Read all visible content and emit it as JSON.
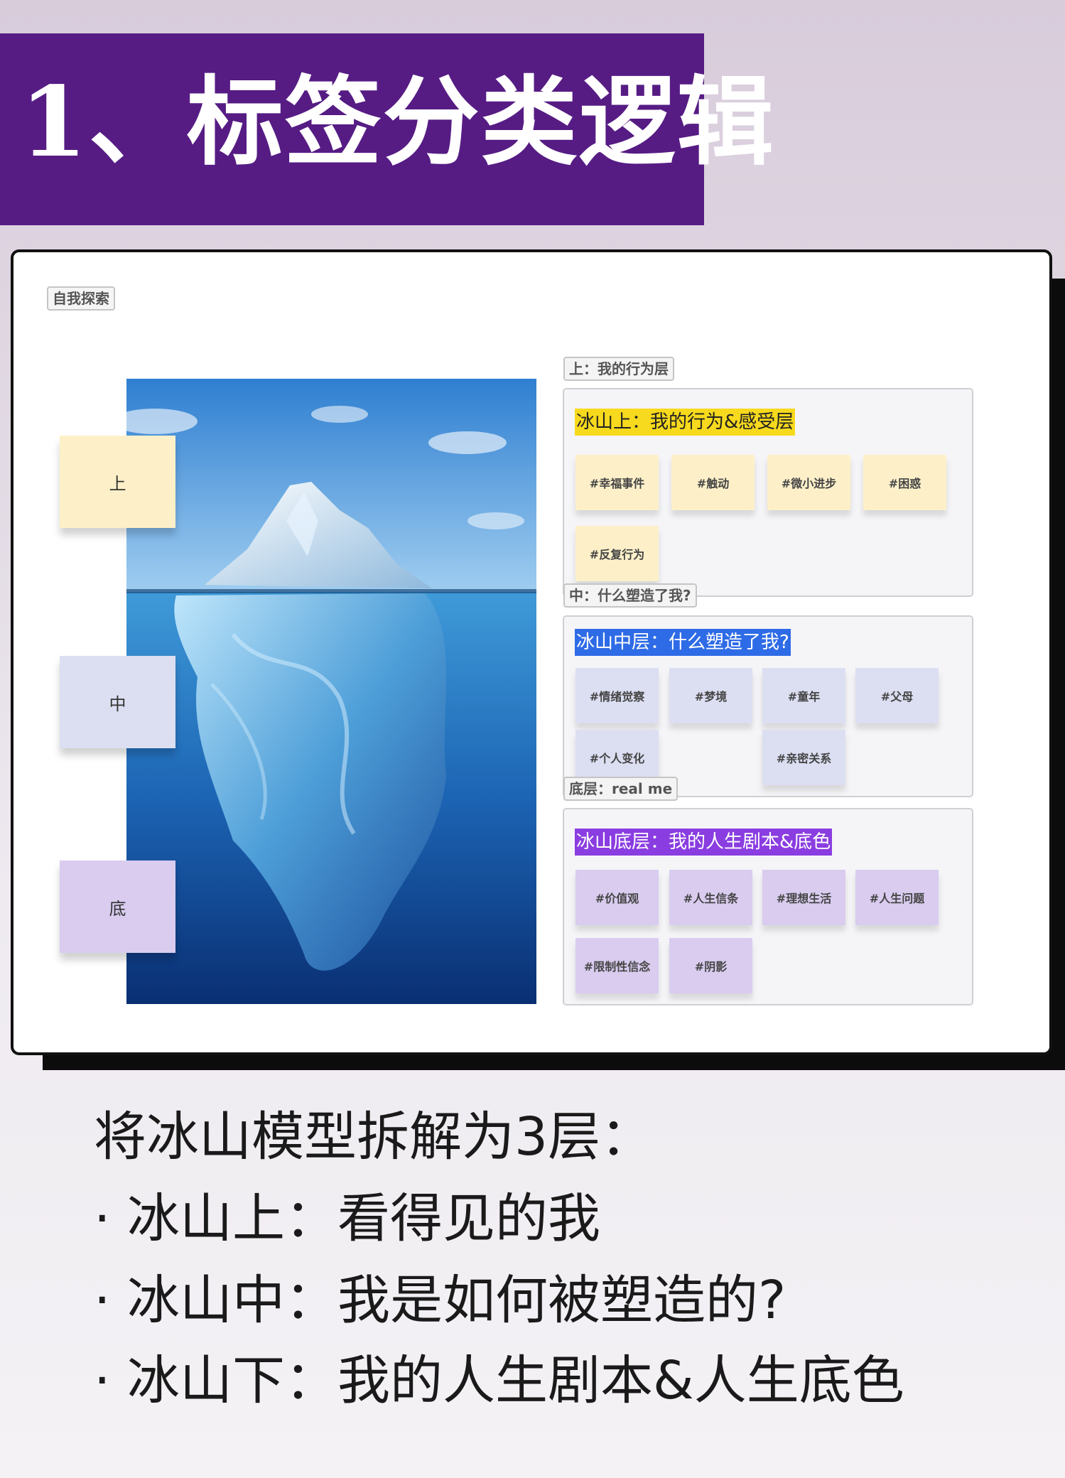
{
  "title": "1、标签分类逻辑",
  "board": {
    "tag": "自我探索",
    "levels": [
      "上",
      "中",
      "底"
    ],
    "sections": [
      {
        "tag": "上：我的行为层",
        "heading": "冰山上：我的行为&感受层",
        "heading_bg": "#f7d91d",
        "heading_color": "#222222",
        "note_color": "#fdf0c9",
        "notes": [
          "#幸福事件",
          "#触动",
          "#微小进步",
          "#困惑",
          "#反复行为"
        ]
      },
      {
        "tag": "中：什么塑造了我?",
        "heading": "冰山中层：什么塑造了我?",
        "heading_bg": "#2e6be6",
        "heading_color": "#ffffff",
        "note_color": "#dcdff2",
        "notes": [
          "#情绪觉察",
          "#梦境",
          "#童年",
          "#父母",
          "#个人变化",
          "#亲密关系"
        ]
      },
      {
        "tag": "底层：real me",
        "heading": "冰山底层：我的人生剧本&底色",
        "heading_bg": "#8a3de0",
        "heading_color": "#ffffff",
        "note_color": "#d9ccef",
        "notes": [
          "#价值观",
          "#人生信条",
          "#理想生活",
          "#人生问题",
          "#限制性信念",
          "#阴影"
        ]
      }
    ]
  },
  "caption": {
    "intro": "将冰山模型拆解为3层：",
    "items": [
      "· 冰山上：看得见的我",
      "· 冰山中：我是如何被塑造的?",
      "· 冰山下：我的人生剧本&人生底色"
    ]
  },
  "colors": {
    "title_bar": "#561c84",
    "level_top": "#fdf0c9",
    "level_mid": "#dcdff2",
    "level_bottom": "#d9ccef"
  }
}
